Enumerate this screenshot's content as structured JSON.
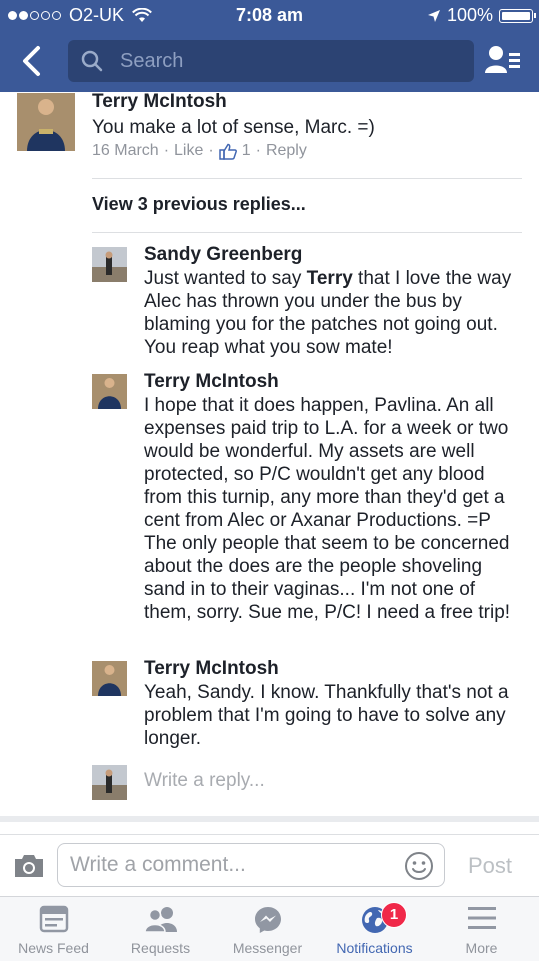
{
  "status_bar": {
    "carrier": "O2-UK",
    "time": "7:08 am",
    "battery": "100%"
  },
  "search": {
    "placeholder": "Search"
  },
  "top_comment": {
    "author": "Terry McIntosh",
    "text": "You make a lot of sense, Marc.  =)",
    "date": "16 March",
    "like_label": "Like",
    "like_count": "1",
    "reply_label": "Reply"
  },
  "view_previous": "View 3 previous replies...",
  "replies": [
    {
      "author": "Sandy Greenberg",
      "lines": [
        "Just wanted to say ",
        "Terry",
        " that I love the way Alec has thrown you under the bus by blaming you for the patches not going out. You reap what you sow mate!"
      ]
    },
    {
      "author": "Terry McIntosh",
      "text": "I hope that it does happen, Pavlina.  An all expenses paid trip to L.A. for a week or two would be wonderful.  My assets are well protected, so P/C wouldn't get any blood from this turnip, any more than they'd get a cent from Alec or Axanar Productions.  =P  The only people that seem to be concerned about the does are the people shoveling sand in to their vaginas... I'm not one of them, sorry.  Sue me, P/C!  I need a free trip!"
    },
    {
      "author": "Terry McIntosh",
      "text": "Yeah, Sandy.  I know.  Thankfully that's not a problem that I'm going to have to solve any longer."
    }
  ],
  "reply_placeholder": "Write a reply...",
  "composer": {
    "placeholder": "Write a comment...",
    "post_label": "Post"
  },
  "tabs": [
    {
      "label": "News Feed",
      "icon": "news-feed-icon"
    },
    {
      "label": "Requests",
      "icon": "friend-requests-icon"
    },
    {
      "label": "Messenger",
      "icon": "messenger-icon"
    },
    {
      "label": "Notifications",
      "icon": "globe-icon",
      "badge": "1",
      "active": true
    },
    {
      "label": "More",
      "icon": "menu-icon"
    }
  ],
  "colors": {
    "brand": "#3b5998",
    "active_tab": "#4267b2",
    "badge": "#f02849"
  }
}
